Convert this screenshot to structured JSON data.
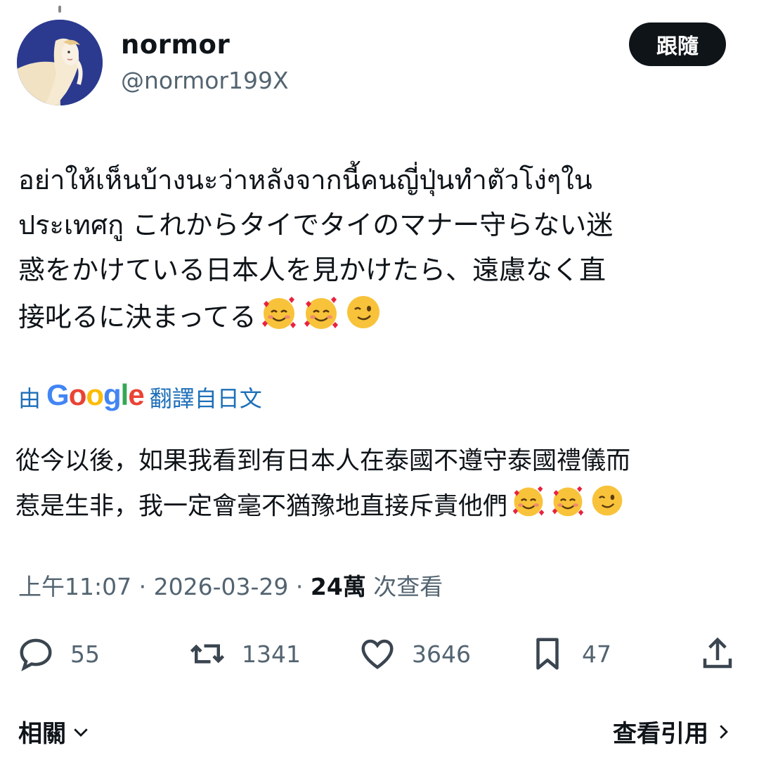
{
  "author": {
    "name": "normor",
    "handle": "@normor199X",
    "follow_label": "跟隨"
  },
  "tweet": {
    "lines": [
      "อย่าให้เห็นบ้างนะว่าหลังจากนี้คนญี่ปุ่นทำตัวโง่ๆใน",
      "ประเทศกู これからタイでタイのマナー守らない迷",
      "惑をかけている日本人を見かけたら、遠慮なく直",
      "接叱るに決まってる"
    ],
    "emojis": [
      "smiling-face-with-hearts",
      "smiling-face-with-hearts",
      "winking-face"
    ]
  },
  "translation": {
    "prefix": "由",
    "logo_text": "Google",
    "suffix": "翻譯自日文",
    "lines": [
      "從今以後，如果我看到有日本人在泰國不遵守泰國禮儀而",
      "惹是生非，我一定會毫不猶豫地直接斥責他們"
    ]
  },
  "meta": {
    "time": "上午11:07",
    "sep1": " · ",
    "date": "2026-03-29",
    "sep2": " · ",
    "views": "24萬",
    "views_suffix": " 次查看"
  },
  "actions": {
    "replies": "55",
    "reposts": "1341",
    "likes": "3646",
    "bookmarks": "47"
  },
  "footer": {
    "related_label": "相關",
    "quotes_label": "查看引用"
  },
  "colors": {
    "link_blue": "#1d6fb8",
    "muted": "#536471",
    "text": "#0f1419"
  }
}
